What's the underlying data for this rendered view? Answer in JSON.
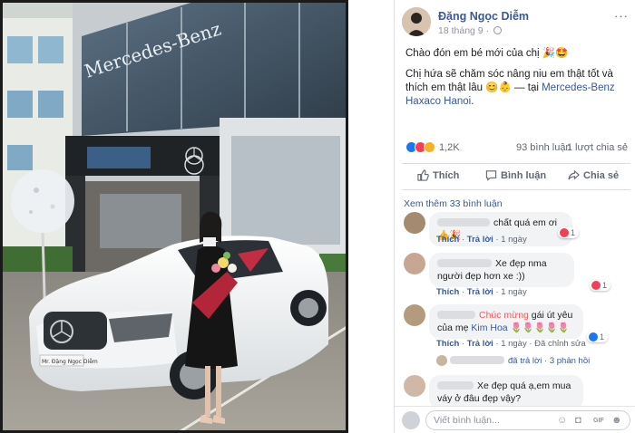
{
  "post": {
    "author_name": "Đặng Ngọc Diễm",
    "date": "18 tháng 9",
    "date_separator": "·",
    "more_label": "···",
    "line1": "Chào đón em bé mới của chị 🎉🤩",
    "line2_text": "Chị hứa sẽ chăm sóc nâng niu em thật tốt và thích em thật lâu 😊👶 — tại ",
    "location": "Mercedes-Benz Haxaco Hanoi",
    "line2_end": "."
  },
  "reactions": {
    "count": "1,2K",
    "comments": "93 bình luận",
    "shares": "1 lượt chia sẻ",
    "icons": [
      "like-icon",
      "love-icon",
      "wow-icon"
    ]
  },
  "actions": {
    "like": "Thích",
    "comment": "Bình luận",
    "share": "Chia sẻ"
  },
  "view_more_comments": "Xem thêm 33 bình luận",
  "comments": [
    {
      "text": "chất quá em ơi 👍🎉",
      "like": "Thích",
      "reply": "Trả lời",
      "time": "1 ngày",
      "react_count": "1",
      "react_color": "#f33e58"
    },
    {
      "text": "Xe đẹp nma người đẹp hơn xe :))",
      "like": "Thích",
      "reply": "Trả lời",
      "time": "1 ngày",
      "react_count": "1",
      "react_color": "#f33e58"
    },
    {
      "mention": "Chúc mừng",
      "text_a": " gái út yêu của mẹ ",
      "mention2": "Kim Hoa",
      "text_b": " 🌷🌷🌷🌷🌷",
      "like": "Thích",
      "reply": "Trả lời",
      "time": "1 ngày",
      "edited": "Đã chỉnh sửa",
      "react_count": "1",
      "react_color": "#1877f2"
    },
    {
      "text": "Xe đẹp quá ạ,em mua váy ở đâu đẹp vậy?"
    }
  ],
  "reply_summary": {
    "text": "đã trả lời",
    "separator": "·",
    "count": "3 phản hồi"
  },
  "composer": {
    "placeholder": "Viết bình luận...",
    "icons": [
      "emoji-icon",
      "camera-icon",
      "gif-icon",
      "sticker-icon"
    ]
  },
  "photo": {
    "showroom_sign": "Mercedes-Benz",
    "plate": "Mr. Đặng Ngọc Diễm"
  },
  "colors": {
    "fb_blue": "#385898",
    "like_blue": "#1877f2",
    "love_red": "#f33e58",
    "wow_yellow": "#f7b125",
    "bubble_grey": "#f2f3f5"
  }
}
